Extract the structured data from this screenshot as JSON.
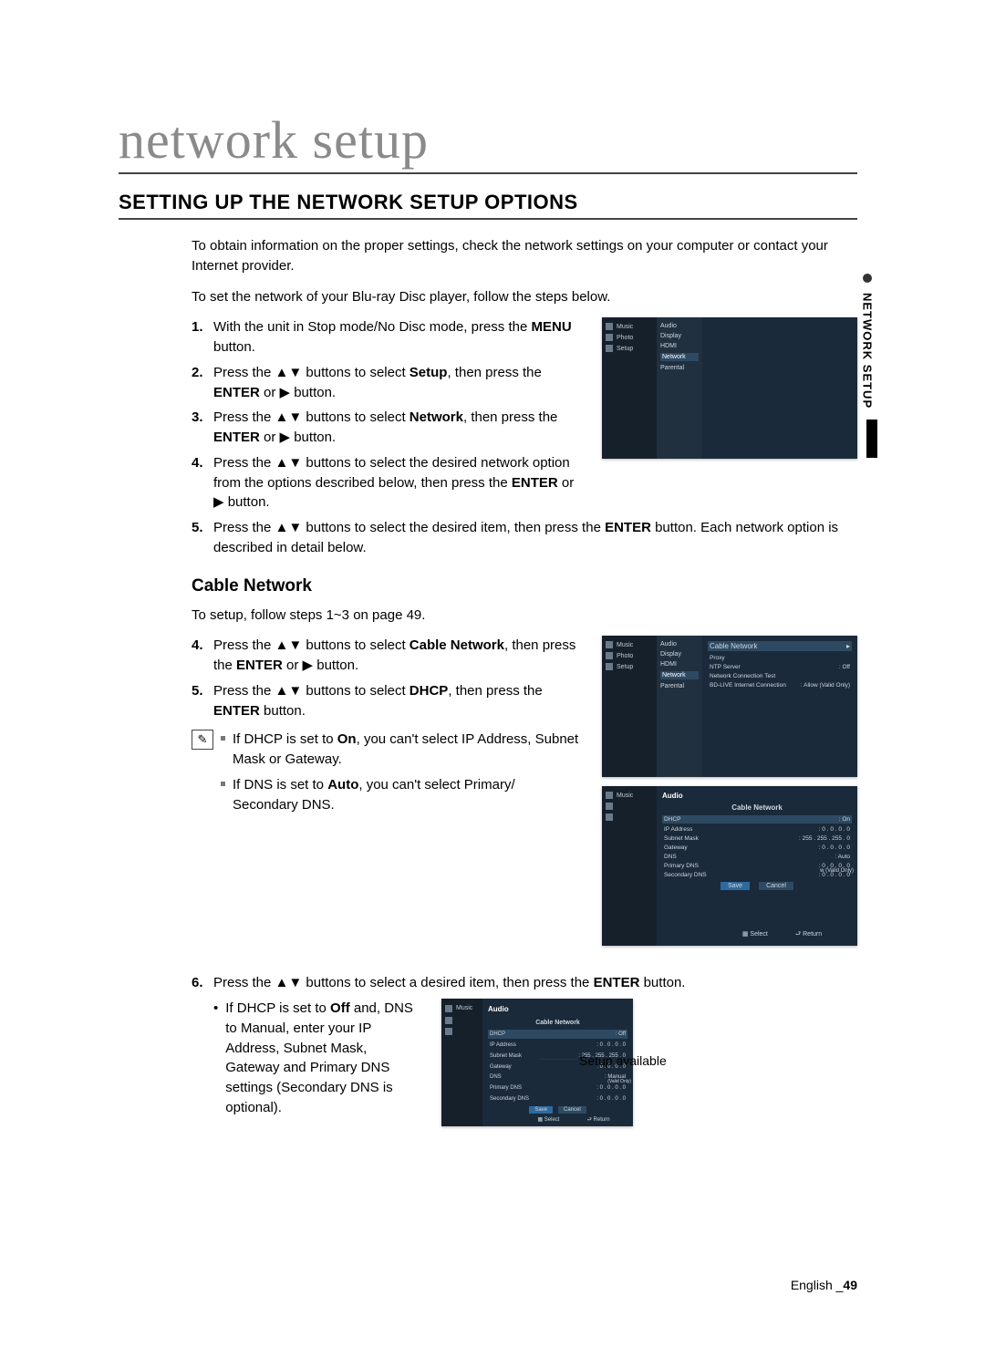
{
  "title": "network setup",
  "section_heading": "SETTING UP THE NETWORK SETUP OPTIONS",
  "intro1": "To obtain information on the proper settings, check the network settings on your computer or contact your Internet provider.",
  "intro2": "To set the network of your Blu-ray Disc player, follow the steps below.",
  "steps": [
    {
      "n": "1.",
      "pre": "With the unit in Stop mode/No Disc mode, press the ",
      "b": "MENU",
      "post": " button."
    },
    {
      "n": "2.",
      "pre": "Press the ▲▼ buttons to select ",
      "b": "Setup",
      "post": ", then press the ",
      "b2": "ENTER",
      "post2": " or ▶ button."
    },
    {
      "n": "3.",
      "pre": "Press the ▲▼ buttons to select ",
      "b": "Network",
      "post": ", then press the ",
      "b2": "ENTER",
      "post2": " or ▶ button."
    },
    {
      "n": "4.",
      "pre": "Press the ▲▼ buttons to select the desired network option from the options described below, then press the ",
      "b": "ENTER",
      "post": " or ▶ button."
    },
    {
      "n": "5.",
      "pre": "Press the ▲▼ buttons to select the desired item, then press the ",
      "b": "ENTER",
      "post": " button. Each network option is described in detail below."
    }
  ],
  "fig1": {
    "sidebar": [
      "Music",
      "Photo",
      "Setup"
    ],
    "menu": [
      "Audio",
      "Display",
      "HDMI",
      "Network",
      "Parental"
    ],
    "highlight": "Network"
  },
  "subheading": "Cable Network",
  "cable_intro": "To setup, follow steps 1~3 on page 49.",
  "cable_steps": [
    {
      "n": "4.",
      "pre": "Press the ▲▼ buttons to select ",
      "b": "Cable Network",
      "post": ", then press the ",
      "b2": "ENTER",
      "post2": " or ▶ button."
    },
    {
      "n": "5.",
      "pre": "Press the ▲▼ buttons to select ",
      "b": "DHCP",
      "post": ", then press the ",
      "b2": "ENTER",
      "post2": " button."
    }
  ],
  "notes": [
    {
      "pre": "If DHCP is set to ",
      "b": "On",
      "post": ", you can't select IP Address, Subnet Mask or Gateway."
    },
    {
      "pre": "If DNS is set to ",
      "b": "Auto",
      "post": ", you can't select Primary/ Secondary DNS."
    }
  ],
  "fig2": {
    "sidebar": [
      "Music",
      "Photo",
      "Setup"
    ],
    "menu": [
      "Audio",
      "Display",
      "HDMI",
      "Network",
      "Parental"
    ],
    "panel_title": "Cable Network",
    "rows": [
      [
        "Proxy",
        ""
      ],
      [
        "NTP Server",
        ": Off"
      ],
      [
        "Network Connection Test",
        ""
      ],
      [
        "BD-LIVE Internet Connection",
        ": Allow (Valid Only)"
      ]
    ]
  },
  "fig3": {
    "title": "Cable Network",
    "rows": [
      [
        "DHCP",
        ": On"
      ],
      [
        "IP Address",
        ": 0 . 0 . 0 . 0"
      ],
      [
        "Subnet Mask",
        ": 255 . 255 . 255 . 0"
      ],
      [
        "Gateway",
        ": 0 . 0 . 0 . 0"
      ],
      [
        "DNS",
        ": Auto"
      ],
      [
        "Primary DNS",
        ": 0 . 0 . 0 . 0"
      ],
      [
        "Secondary DNS",
        ": 0 . 0 . 0 . 0"
      ]
    ],
    "buttons": [
      "Save",
      "Cancel"
    ],
    "footer": [
      "Select",
      "Return"
    ],
    "right_note": "w (Valid Only)"
  },
  "step6": {
    "n": "6.",
    "pre": "Press the ▲▼ buttons to select a desired item, then press the ",
    "b": "ENTER",
    "post": " button.",
    "bullet_pre": "If DHCP is set to ",
    "bullet_b": "Off",
    "bullet_post": " and, DNS to Manual, enter your IP Address, Subnet Mask, Gateway and Primary DNS settings (Secondary DNS is optional)."
  },
  "fig4": {
    "title": "Cable Network",
    "rows": [
      [
        "DHCP",
        ": Off"
      ],
      [
        "IP Address",
        ": 0 . 0 . 0 . 0"
      ],
      [
        "Subnet Mask",
        ": 255 . 255 . 255 . 0"
      ],
      [
        "Gateway",
        ": 0 . 0 . 0 . 0"
      ],
      [
        "DNS",
        ": Manual"
      ],
      [
        "Primary DNS",
        ": 0 . 0 . 0 . 0"
      ],
      [
        "Secondary DNS",
        ": 0 . 0 . 0 . 0"
      ]
    ],
    "buttons": [
      "Save",
      "Cancel"
    ],
    "footer": [
      "Select",
      "Return"
    ],
    "right_note": "(Valid Only)"
  },
  "setup_available": "Setup available",
  "vtab": "NETWORK SETUP",
  "footer_lang": "English ",
  "footer_page": "49"
}
